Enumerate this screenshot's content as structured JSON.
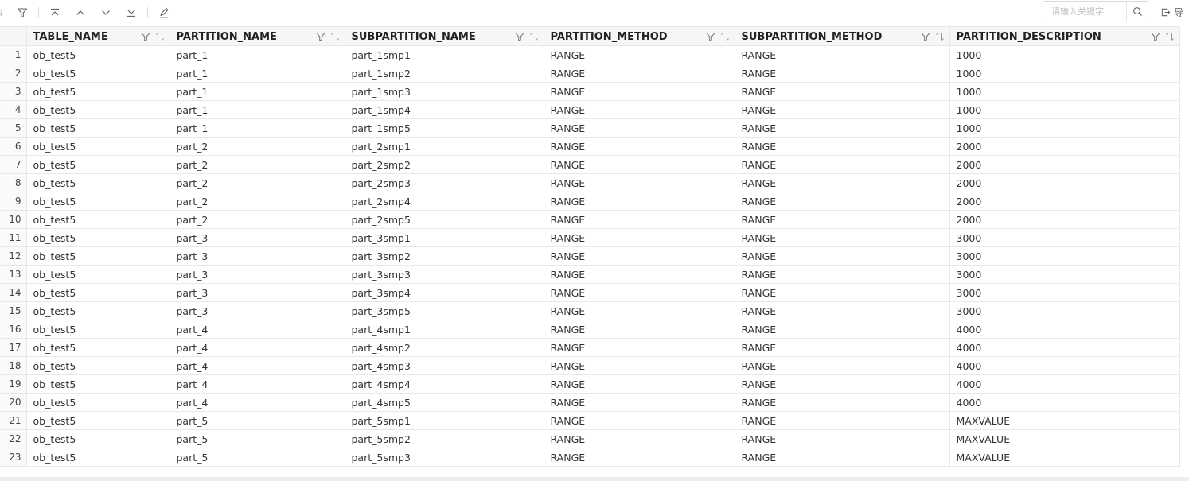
{
  "toolbar": {
    "search": {
      "placeholder": "请输入关键字"
    },
    "export_label": "导"
  },
  "table": {
    "columns": [
      "TABLE_NAME",
      "PARTITION_NAME",
      "SUBPARTITION_NAME",
      "PARTITION_METHOD",
      "SUBPARTITION_METHOD",
      "PARTITION_DESCRIPTION"
    ],
    "rows": [
      [
        "1",
        "ob_test5",
        "part_1",
        "part_1smp1",
        "RANGE",
        "RANGE",
        "1000"
      ],
      [
        "2",
        "ob_test5",
        "part_1",
        "part_1smp2",
        "RANGE",
        "RANGE",
        "1000"
      ],
      [
        "3",
        "ob_test5",
        "part_1",
        "part_1smp3",
        "RANGE",
        "RANGE",
        "1000"
      ],
      [
        "4",
        "ob_test5",
        "part_1",
        "part_1smp4",
        "RANGE",
        "RANGE",
        "1000"
      ],
      [
        "5",
        "ob_test5",
        "part_1",
        "part_1smp5",
        "RANGE",
        "RANGE",
        "1000"
      ],
      [
        "6",
        "ob_test5",
        "part_2",
        "part_2smp1",
        "RANGE",
        "RANGE",
        "2000"
      ],
      [
        "7",
        "ob_test5",
        "part_2",
        "part_2smp2",
        "RANGE",
        "RANGE",
        "2000"
      ],
      [
        "8",
        "ob_test5",
        "part_2",
        "part_2smp3",
        "RANGE",
        "RANGE",
        "2000"
      ],
      [
        "9",
        "ob_test5",
        "part_2",
        "part_2smp4",
        "RANGE",
        "RANGE",
        "2000"
      ],
      [
        "10",
        "ob_test5",
        "part_2",
        "part_2smp5",
        "RANGE",
        "RANGE",
        "2000"
      ],
      [
        "11",
        "ob_test5",
        "part_3",
        "part_3smp1",
        "RANGE",
        "RANGE",
        "3000"
      ],
      [
        "12",
        "ob_test5",
        "part_3",
        "part_3smp2",
        "RANGE",
        "RANGE",
        "3000"
      ],
      [
        "13",
        "ob_test5",
        "part_3",
        "part_3smp3",
        "RANGE",
        "RANGE",
        "3000"
      ],
      [
        "14",
        "ob_test5",
        "part_3",
        "part_3smp4",
        "RANGE",
        "RANGE",
        "3000"
      ],
      [
        "15",
        "ob_test5",
        "part_3",
        "part_3smp5",
        "RANGE",
        "RANGE",
        "3000"
      ],
      [
        "16",
        "ob_test5",
        "part_4",
        "part_4smp1",
        "RANGE",
        "RANGE",
        "4000"
      ],
      [
        "17",
        "ob_test5",
        "part_4",
        "part_4smp2",
        "RANGE",
        "RANGE",
        "4000"
      ],
      [
        "18",
        "ob_test5",
        "part_4",
        "part_4smp3",
        "RANGE",
        "RANGE",
        "4000"
      ],
      [
        "19",
        "ob_test5",
        "part_4",
        "part_4smp4",
        "RANGE",
        "RANGE",
        "4000"
      ],
      [
        "20",
        "ob_test5",
        "part_4",
        "part_4smp5",
        "RANGE",
        "RANGE",
        "4000"
      ],
      [
        "21",
        "ob_test5",
        "part_5",
        "part_5smp1",
        "RANGE",
        "RANGE",
        "MAXVALUE"
      ],
      [
        "22",
        "ob_test5",
        "part_5",
        "part_5smp2",
        "RANGE",
        "RANGE",
        "MAXVALUE"
      ],
      [
        "23",
        "ob_test5",
        "part_5",
        "part_5smp3",
        "RANGE",
        "RANGE",
        "MAXVALUE"
      ]
    ]
  },
  "icons": {
    "filter": "filter-icon",
    "scroll_top": "scroll-to-top-icon",
    "prev": "chevron-up-icon",
    "next": "chevron-down-icon",
    "scroll_bottom": "scroll-to-bottom-icon",
    "edit": "edit-pen-icon",
    "search": "search-icon",
    "export": "export-icon",
    "column_filter": "column-filter-icon",
    "column_sort": "column-sort-icon"
  },
  "colors": {
    "header_bg": "#f5f6f8",
    "grid_line": "#e8e8e8",
    "icon": "#666666"
  }
}
